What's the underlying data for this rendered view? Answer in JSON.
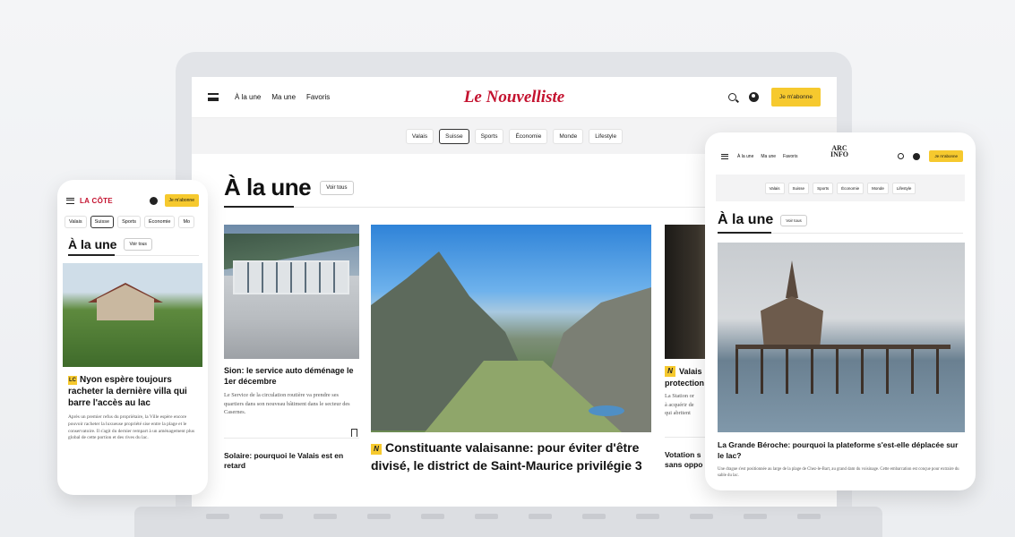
{
  "laptop": {
    "nav": {
      "links": [
        "À la une",
        "Ma une",
        "Favoris"
      ],
      "logo": "Le Nouvelliste",
      "subscribe": "Je m'abonne"
    },
    "tabs": [
      "Valais",
      "Suisse",
      "Sports",
      "Économie",
      "Monde",
      "Lifestyle"
    ],
    "active_tab": "Suisse",
    "section": {
      "title": "À la une",
      "see_all": "Voir tous"
    },
    "card_left": {
      "title": "Sion: le service auto déménage le 1er décembre",
      "desc": "Le Service de la circulation routière va prendre ses quartiers dans son nouveau bâtiment dans le secteur des Casernes.",
      "title2": "Solaire: pourquoi le Valais est en retard"
    },
    "card_main": {
      "badge": "N",
      "title": "Constituante valaisanne: pour éviter d'être divisé, le district de Saint-Maurice privilégie 3"
    },
    "card_right": {
      "badge": "N",
      "title_lines": [
        "Valais",
        "protection"
      ],
      "desc_lines": [
        "La Station or",
        "à acquérir de",
        "qui abritent"
      ],
      "title2_lines": [
        "Votation s",
        "sans oppo"
      ]
    }
  },
  "phone": {
    "logo": "LA CÔTE",
    "subscribe": "Je m'abonne",
    "tabs": [
      "Valais",
      "Suisse",
      "Sports",
      "Économie",
      "Mo"
    ],
    "active_tab": "Suisse",
    "section": {
      "title": "À la une",
      "see_all": "Voir tous"
    },
    "article": {
      "badge": "LC",
      "title": "Nyon espère toujours racheter la dernière villa qui barre l'accès au lac",
      "desc": "Après un premier refus du propriétaire, la Ville espère encore pouvoir racheter la luxueuse propriété sise entre la plage et le conservatoire. Il s'agit du dernier rempart à un aménagement plus global de cette portion et des rives du lac."
    }
  },
  "tablet": {
    "nav": {
      "links": [
        "À la une",
        "Ma une",
        "Favoris"
      ],
      "logo_line1": "ARC",
      "logo_line2": "INFO",
      "subscribe": "Je m'abonne"
    },
    "tabs": [
      "Valais",
      "Suisse",
      "Sports",
      "Économie",
      "Monde",
      "Lifestyle"
    ],
    "section": {
      "title": "À la une",
      "see_all": "Voir tous"
    },
    "article": {
      "title": "La Grande Béroche: pourquoi la plateforme s'est-elle déplacée sur le lac?",
      "desc": "Une drague s'est positionnée au large de la plage de Chez-le-Bart, au grand dam du voisinage. Cette embarcation est conçue pour extraire du sable du lac."
    }
  }
}
